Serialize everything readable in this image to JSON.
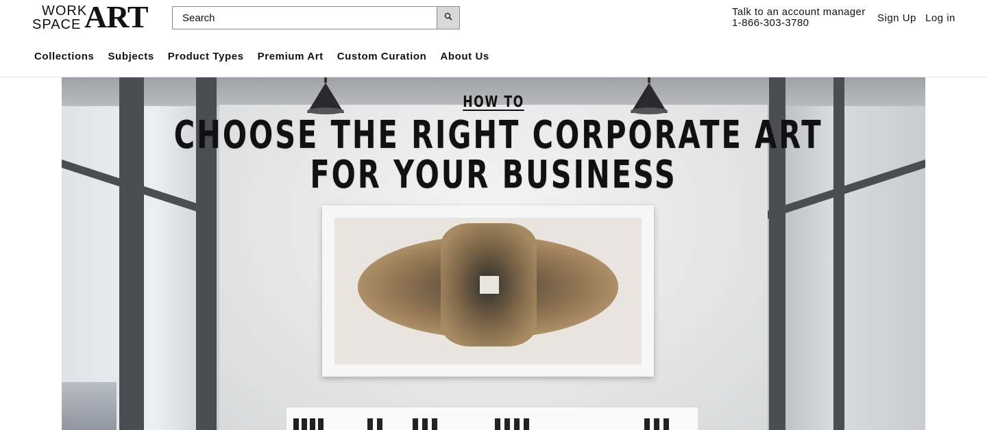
{
  "brand": {
    "word1": "WORK",
    "word2": "SPACE",
    "word3": "ART"
  },
  "search": {
    "placeholder": "Search"
  },
  "contact": {
    "line1": "Talk to an account manager",
    "phone": "1-866-303-3780"
  },
  "auth": {
    "signup": "Sign Up",
    "login": "Log in"
  },
  "nav": [
    "Collections",
    "Subjects",
    "Product Types",
    "Premium Art",
    "Custom Curation",
    "About Us"
  ],
  "hero": {
    "kicker": "HOW TO",
    "headline_line1": "CHOOSE THE RIGHT CORPORATE ART",
    "headline_line2": "FOR YOUR BUSINESS"
  },
  "icons": {
    "search": "search-icon"
  },
  "colors": {
    "text": "#111111",
    "hero_text": "#ffffff",
    "search_button": "#d9d9d9"
  }
}
